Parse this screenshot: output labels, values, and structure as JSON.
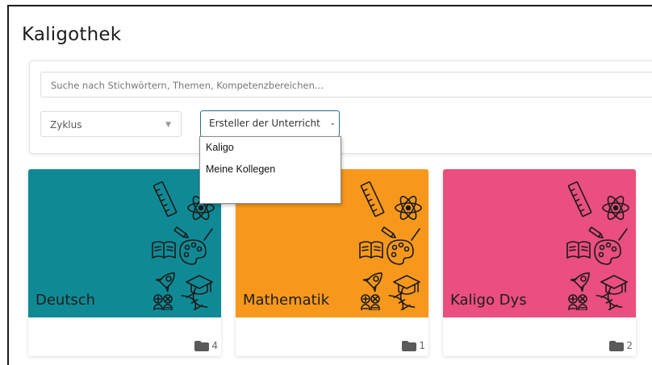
{
  "title": "Kaligothek",
  "search": {
    "placeholder": "Suche nach Stichwörtern, Themen, Kompetenzbereichen..."
  },
  "filters": {
    "zyklus": {
      "value": "Zyklus"
    },
    "ersteller": {
      "value": "Ersteller der Unterricht"
    }
  },
  "dropdown": {
    "options": [
      "Kaligo",
      "Meine Kollegen"
    ]
  },
  "cards": [
    {
      "subject": "Deutsch",
      "count": "4",
      "color": "#0f8a95"
    },
    {
      "subject": "Mathematik",
      "count": "1",
      "color": "#f7981c"
    },
    {
      "subject": "Kaligo Dys",
      "count": "2",
      "color": "#ea4f7f"
    }
  ],
  "icons": {
    "card_decoration": [
      "ruler-icon",
      "atom-icon",
      "book-icon",
      "palette-icon",
      "rocket-icon",
      "graduation-cap-icon",
      "math-symbols-icon",
      "dna-icon"
    ],
    "folder": "folder-icon",
    "select_caret": "chevron-down-icon"
  }
}
